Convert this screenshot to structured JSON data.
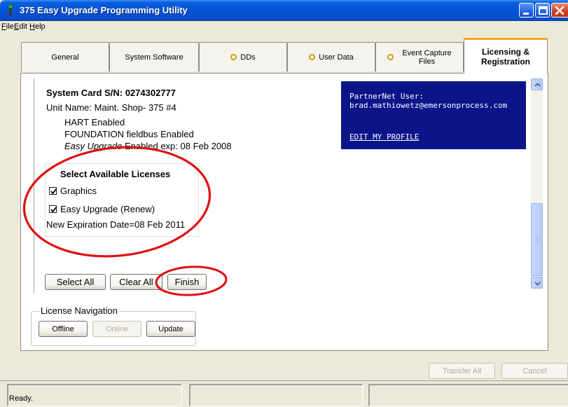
{
  "window": {
    "title": "375 Easy Upgrade Programming Utility"
  },
  "menu": {
    "items": [
      {
        "label": "File",
        "accel": "F",
        "rest": "ile"
      },
      {
        "label": "Edit",
        "accel": "E",
        "rest": "dit"
      },
      {
        "label": "Help",
        "accel": "H",
        "rest": "elp"
      }
    ]
  },
  "tabs": [
    {
      "label": "General",
      "icon": ""
    },
    {
      "label": "System Software",
      "icon": ""
    },
    {
      "label": "DDs",
      "icon": "pending-ring-icon"
    },
    {
      "label": "User Data",
      "icon": "pending-ring-icon"
    },
    {
      "label_line1": "Event Capture",
      "label_line2": "Files",
      "icon": "pending-ring-icon"
    },
    {
      "label_line1": "Licensing &",
      "label_line2": "Registration",
      "active": true
    }
  ],
  "system_card": {
    "serial_label": "System Card S/N: 0274302777",
    "unit_name": "Unit Name: Maint. Shop- 375 #4",
    "features": [
      "HART Enabled",
      "FOUNDATION fieldbus Enabled"
    ],
    "easy_upgrade_prefix": "Easy Upgrade",
    "easy_upgrade_suffix": " Enabled exp: 08 Feb 2008"
  },
  "partner": {
    "label": "PartnerNet User:",
    "email": "brad.mathiowetz@emersonprocess.com",
    "edit_link": "EDIT MY PROFILE",
    "bg_color": "#0b1488"
  },
  "licenses": {
    "title": "Select Available Licenses",
    "options": [
      {
        "label": "Graphics",
        "checked": true
      },
      {
        "label": "Easy Upgrade (Renew)",
        "checked": true
      }
    ],
    "new_expiration": "New Expiration Date=08 Feb 2011"
  },
  "actions": {
    "select_all": "Select All",
    "clear_all": "Clear All",
    "finish": "Finish"
  },
  "license_navigation": {
    "title": "License Navigation",
    "offline": "Offline",
    "online": "Online",
    "update": "Update"
  },
  "dialog": {
    "transfer_all": "Transfer All",
    "cancel": "Cancel"
  },
  "status": {
    "text": "Ready."
  },
  "colors": {
    "annotation_red": "#e01010",
    "active_tab_accent": "#f5a623",
    "titlebar_blue": "#0552d6"
  }
}
